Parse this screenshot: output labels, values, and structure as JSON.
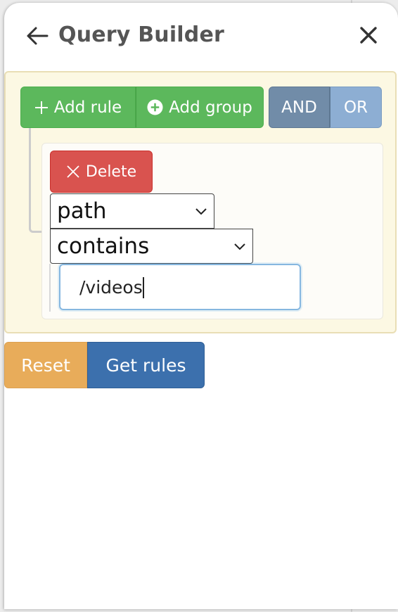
{
  "header": {
    "title": "Query Builder",
    "back_icon": "arrow-left-icon",
    "close_icon": "close-icon"
  },
  "group": {
    "add_rule_label": "Add rule",
    "add_group_label": "Add group",
    "conditions": [
      "AND",
      "OR"
    ],
    "selected_condition": "AND"
  },
  "rule": {
    "delete_label": "Delete",
    "field": "path",
    "operator": "contains",
    "value": "/videos"
  },
  "footer": {
    "reset_label": "Reset",
    "get_rules_label": "Get rules"
  },
  "colors": {
    "success": "#5cb85c",
    "danger": "#d9534f",
    "warning": "#e8ac5a",
    "primary": "#3c70ad",
    "group_bg": "#fcf8e3"
  }
}
